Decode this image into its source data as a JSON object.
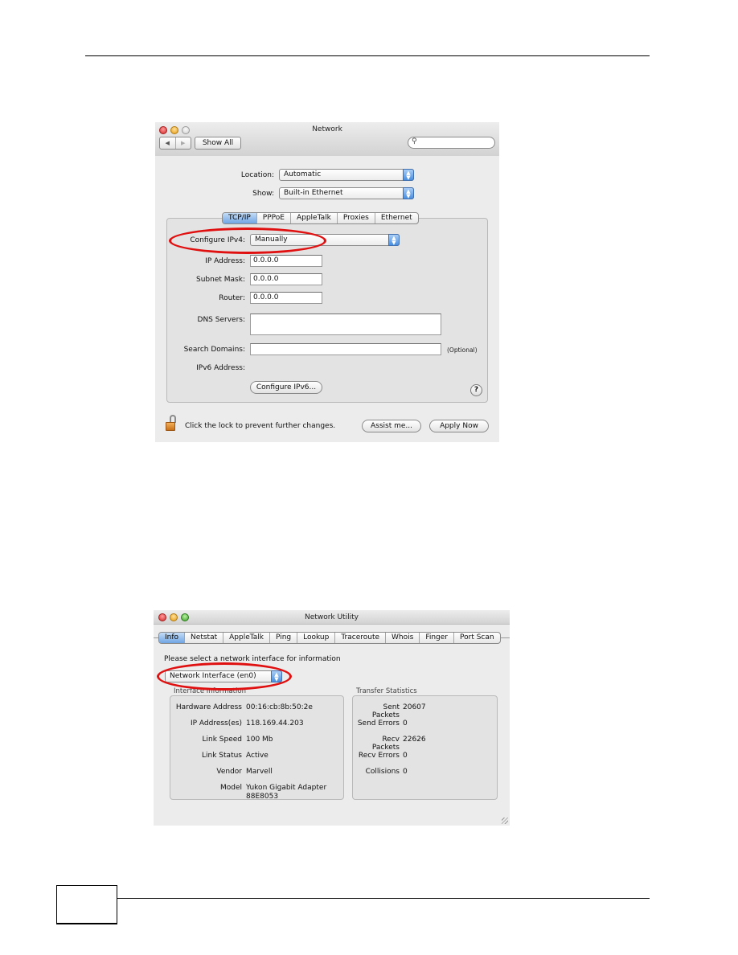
{
  "network_window": {
    "title": "Network",
    "nav_back_icon": "back-arrow-icon",
    "nav_forward_icon": "forward-arrow-icon",
    "show_all_label": "Show All",
    "search": {
      "placeholder": "",
      "value": ""
    },
    "location": {
      "label": "Location:",
      "value": "Automatic"
    },
    "show": {
      "label": "Show:",
      "value": "Built-in Ethernet"
    },
    "tabs": [
      {
        "label": "TCP/IP",
        "selected": true
      },
      {
        "label": "PPPoE",
        "selected": false
      },
      {
        "label": "AppleTalk",
        "selected": false
      },
      {
        "label": "Proxies",
        "selected": false
      },
      {
        "label": "Ethernet",
        "selected": false
      }
    ],
    "configure_ipv4": {
      "label": "Configure IPv4:",
      "value": "Manually"
    },
    "ip_address": {
      "label": "IP Address:",
      "value": "0.0.0.0"
    },
    "subnet_mask": {
      "label": "Subnet Mask:",
      "value": "0.0.0.0"
    },
    "router": {
      "label": "Router:",
      "value": "0.0.0.0"
    },
    "dns_servers": {
      "label": "DNS Servers:",
      "value": ""
    },
    "search_domains": {
      "label": "Search Domains:",
      "value": "",
      "hint": "(Optional)"
    },
    "ipv6_address": {
      "label": "IPv6 Address:",
      "value": ""
    },
    "configure_ipv6_label": "Configure IPv6...",
    "help_label": "?",
    "lock_text": "Click the lock to prevent further changes.",
    "assist_label": "Assist me...",
    "apply_label": "Apply Now"
  },
  "utility_window": {
    "title": "Network Utility",
    "tabs": [
      {
        "label": "Info",
        "selected": true
      },
      {
        "label": "Netstat",
        "selected": false
      },
      {
        "label": "AppleTalk",
        "selected": false
      },
      {
        "label": "Ping",
        "selected": false
      },
      {
        "label": "Lookup",
        "selected": false
      },
      {
        "label": "Traceroute",
        "selected": false
      },
      {
        "label": "Whois",
        "selected": false
      },
      {
        "label": "Finger",
        "selected": false
      },
      {
        "label": "Port Scan",
        "selected": false
      }
    ],
    "prompt": "Please select a network interface for information",
    "interface_select": "Network Interface (en0)",
    "interface_info": {
      "heading": "Interface Information",
      "rows": [
        {
          "key": "Hardware Address",
          "value": "00:16:cb:8b:50:2e"
        },
        {
          "key": "IP Address(es)",
          "value": "118.169.44.203"
        },
        {
          "key": "Link Speed",
          "value": "100 Mb"
        },
        {
          "key": "Link Status",
          "value": "Active"
        },
        {
          "key": "Vendor",
          "value": "Marvell"
        },
        {
          "key": "Model",
          "value": "Yukon Gigabit Adapter",
          "value2": "88E8053"
        }
      ]
    },
    "transfer_stats": {
      "heading": "Transfer Statistics",
      "rows": [
        {
          "key": "Sent Packets",
          "value": "20607"
        },
        {
          "key": "Send Errors",
          "value": "0"
        },
        {
          "key": "Recv Packets",
          "value": "22626"
        },
        {
          "key": "Recv Errors",
          "value": "0"
        },
        {
          "key": "Collisions",
          "value": "0"
        }
      ]
    }
  },
  "highlight_color": "#e01010"
}
